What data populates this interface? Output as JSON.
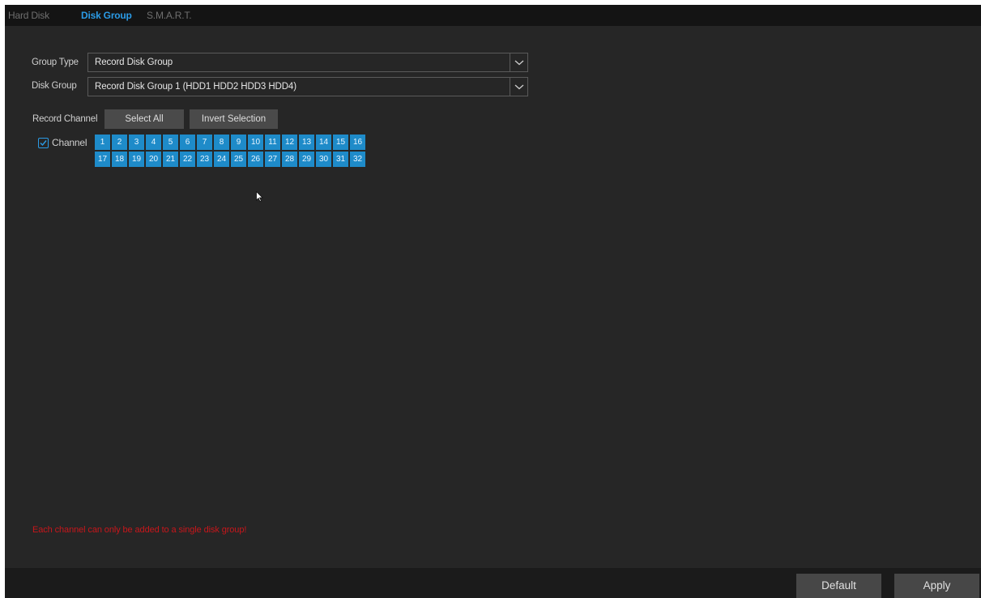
{
  "tabs": [
    {
      "label": "Hard Disk",
      "active": false
    },
    {
      "label": "Disk Group",
      "active": true
    },
    {
      "label": "S.M.A.R.T.",
      "active": false
    }
  ],
  "form": {
    "group_type_label": "Group Type",
    "group_type_value": "Record Disk Group",
    "disk_group_label": "Disk Group",
    "disk_group_value": "Record Disk Group 1 (HDD1 HDD2 HDD3 HDD4)",
    "record_channel_label": "Record Channel",
    "select_all_label": "Select All",
    "invert_selection_label": "Invert Selection",
    "channel_label": "Channel",
    "channel_checked": true,
    "channels": [
      "1",
      "2",
      "3",
      "4",
      "5",
      "6",
      "7",
      "8",
      "9",
      "10",
      "11",
      "12",
      "13",
      "14",
      "15",
      "16",
      "17",
      "18",
      "19",
      "20",
      "21",
      "22",
      "23",
      "24",
      "25",
      "26",
      "27",
      "28",
      "29",
      "30",
      "31",
      "32"
    ]
  },
  "warning": "Each channel can only be added to a single disk group!",
  "footer": {
    "default_label": "Default",
    "apply_label": "Apply"
  },
  "colors": {
    "accent": "#2b9be6",
    "channel_selected": "#1e8bc9",
    "warning": "#c8161b",
    "background": "#262626"
  },
  "icons": {
    "dropdown": "chevron-down-icon",
    "checkbox": "check-icon",
    "cursor": "mouse-pointer-icon"
  }
}
